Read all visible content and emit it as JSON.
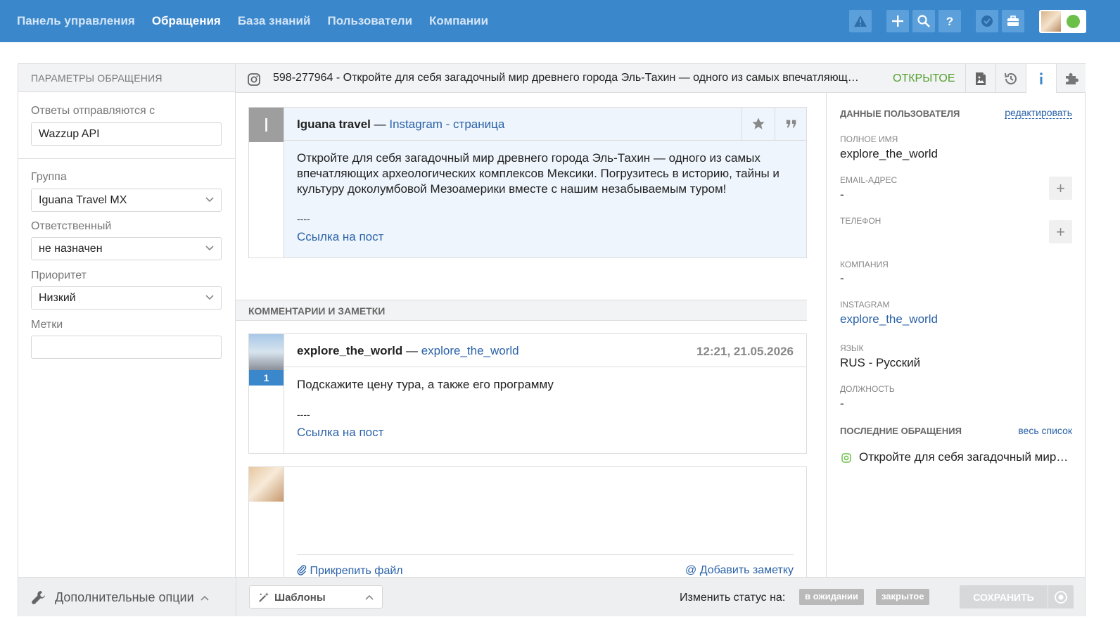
{
  "nav": {
    "items": [
      "Панель управления",
      "Обращения",
      "База знаний",
      "Пользователи",
      "Компании"
    ],
    "active_index": 1
  },
  "topbar_icons": [
    "warning-icon",
    "plus-icon",
    "search-icon",
    "help-icon",
    "check-badge-icon",
    "briefcase-icon"
  ],
  "colors": {
    "topbar": "#3b87cc",
    "status_open": "#56a033",
    "online": "#6cc04a",
    "link": "#2a62a8"
  },
  "left": {
    "title": "ПАРАМЕТРЫ ОБРАЩЕНИЯ",
    "reply_from_label": "Ответы отправляются с",
    "reply_from_value": "Wazzup API",
    "group_label": "Группа",
    "group_value": "Iguana Travel MX",
    "assignee_label": "Ответственный",
    "assignee_value": "не назначен",
    "priority_label": "Приоритет",
    "priority_value": "Низкий",
    "tags_label": "Метки",
    "tags_value": ""
  },
  "ticket": {
    "subject": "598-277964 - Откройте для себя загадочный мир древнего города Эль-Тахин — одного из самых впечатляющ…",
    "status": "ОТКРЫТОЕ"
  },
  "original_post": {
    "avatar_letter": "I",
    "author": "Iguana travel",
    "separator": "—",
    "source": "Instagram - страница",
    "text": "Откройте для себя загадочный мир древнего города Эль-Тахин — одного из самых впечатляющих археологических комплексов Мексики. Погрузитесь в историю, тайны и культуру доколумбовой Мезоамерики вместе с нашим незабываемым туром!",
    "divider": "----",
    "link": "Ссылка на пост"
  },
  "comments_title": "КОММЕНТАРИИ И ЗАМЕТКИ",
  "comment": {
    "author": "explore_the_world",
    "separator": "—",
    "handle": "explore_the_world",
    "time": "12:21, 21.05.2026",
    "badge": "1",
    "text": "Подскажите цену тура, а также его программу",
    "divider": "----",
    "link": "Ссылка на пост"
  },
  "reply": {
    "attach": "Прикрепить файл",
    "add_note": "Добавить заметку"
  },
  "user_data": {
    "title": "ДАННЫЕ ПОЛЬЗОВАТЕЛЯ",
    "edit": "редактировать",
    "fullname_label": "ПОЛНОЕ ИМЯ",
    "fullname": "explore_the_world",
    "email_label": "EMAIL-АДРЕС",
    "email": "-",
    "phone_label": "ТЕЛЕФОН",
    "company_label": "КОМПАНИЯ",
    "company": "-",
    "instagram_label": "INSTAGRAM",
    "instagram": "explore_the_world",
    "lang_label": "ЯЗЫК",
    "lang": "RUS - Русский",
    "position_label": "ДОЛЖНОСТЬ",
    "position": "-",
    "recent_title": "ПОСЛЕДНИЕ ОБРАЩЕНИЯ",
    "recent_all": "весь список",
    "recent_item": "Откройте для себя загадочный мир…"
  },
  "bottom": {
    "more_options": "Дополнительные опции",
    "templates": "Шаблоны",
    "change_status": "Изменить статус на:",
    "status_pending": "в ожидании",
    "status_closed": "закрытое",
    "save": "СОХРАНИТЬ"
  }
}
